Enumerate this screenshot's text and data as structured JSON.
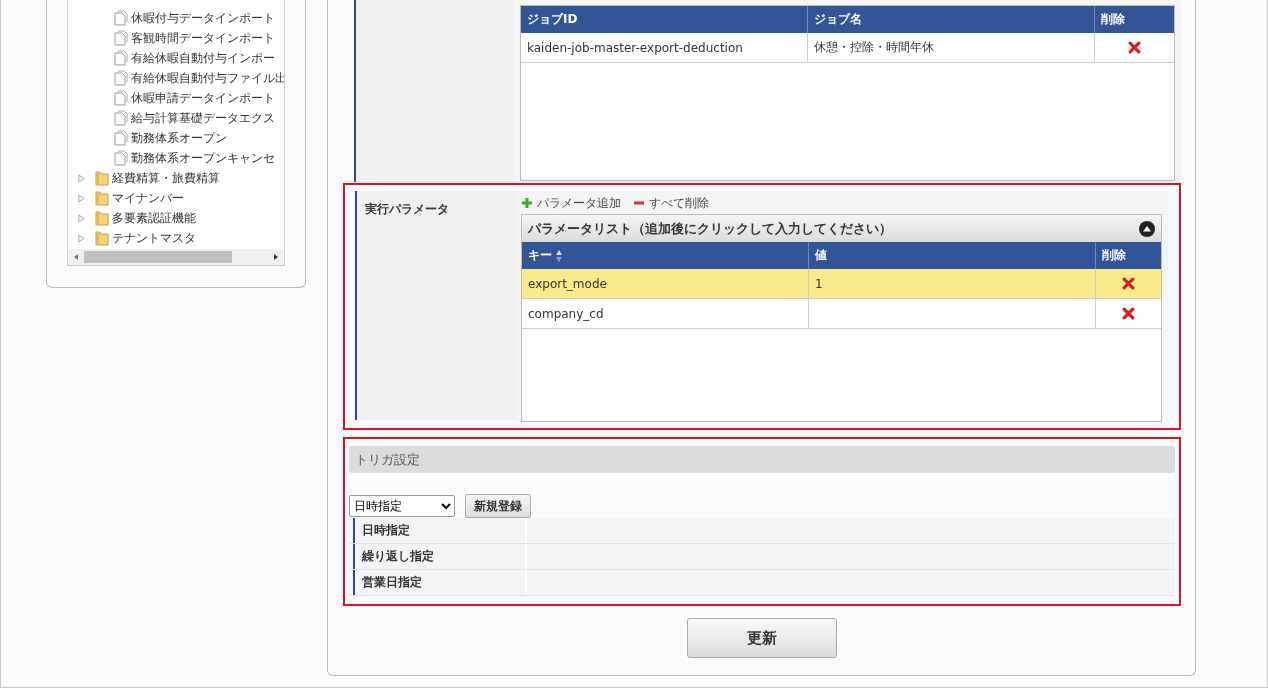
{
  "tree": {
    "items": [
      {
        "kind": "file",
        "label": "休暇付与データインポート"
      },
      {
        "kind": "file",
        "label": "客観時間データインポート"
      },
      {
        "kind": "file",
        "label": "有給休暇自動付与インポー"
      },
      {
        "kind": "file",
        "label": "有給休暇自動付与ファイル出"
      },
      {
        "kind": "file",
        "label": "休暇申請データインポート"
      },
      {
        "kind": "file",
        "label": "給与計算基礎データエクス"
      },
      {
        "kind": "file",
        "label": "勤務体系オープン"
      },
      {
        "kind": "file",
        "label": "勤務体系オープンキャンセ"
      },
      {
        "kind": "folder",
        "label": "経費精算・旅費精算",
        "expanded": false
      },
      {
        "kind": "folder",
        "label": "マイナンバー",
        "expanded": false
      },
      {
        "kind": "folder",
        "label": "多要素認証機能",
        "expanded": false
      },
      {
        "kind": "folder",
        "label": "テナントマスタ",
        "expanded": false
      }
    ]
  },
  "jobs": {
    "columns": [
      "ジョブID",
      "ジョブ名",
      "削除"
    ],
    "rows": [
      {
        "id": "kaiden-job-master-export-deduction",
        "name": "休憩・控除・時間年休"
      }
    ]
  },
  "parameters": {
    "label": "実行パラメータ",
    "add": "パラメータ追加",
    "delete_all": "すべて削除",
    "panel_title": "パラメータリスト（追加後にクリックして入力してください）",
    "columns": [
      "キー",
      "値",
      "削除"
    ],
    "rows": [
      {
        "key": "export_mode",
        "value": "1",
        "selected": true
      },
      {
        "key": "company_cd",
        "value": "",
        "selected": false
      }
    ]
  },
  "trigger": {
    "title": "トリガ設定",
    "select_value": "日時指定",
    "new_button": "新規登録",
    "rows": [
      "日時指定",
      "繰り返し指定",
      "営業日指定"
    ]
  },
  "update_button": "更新"
}
